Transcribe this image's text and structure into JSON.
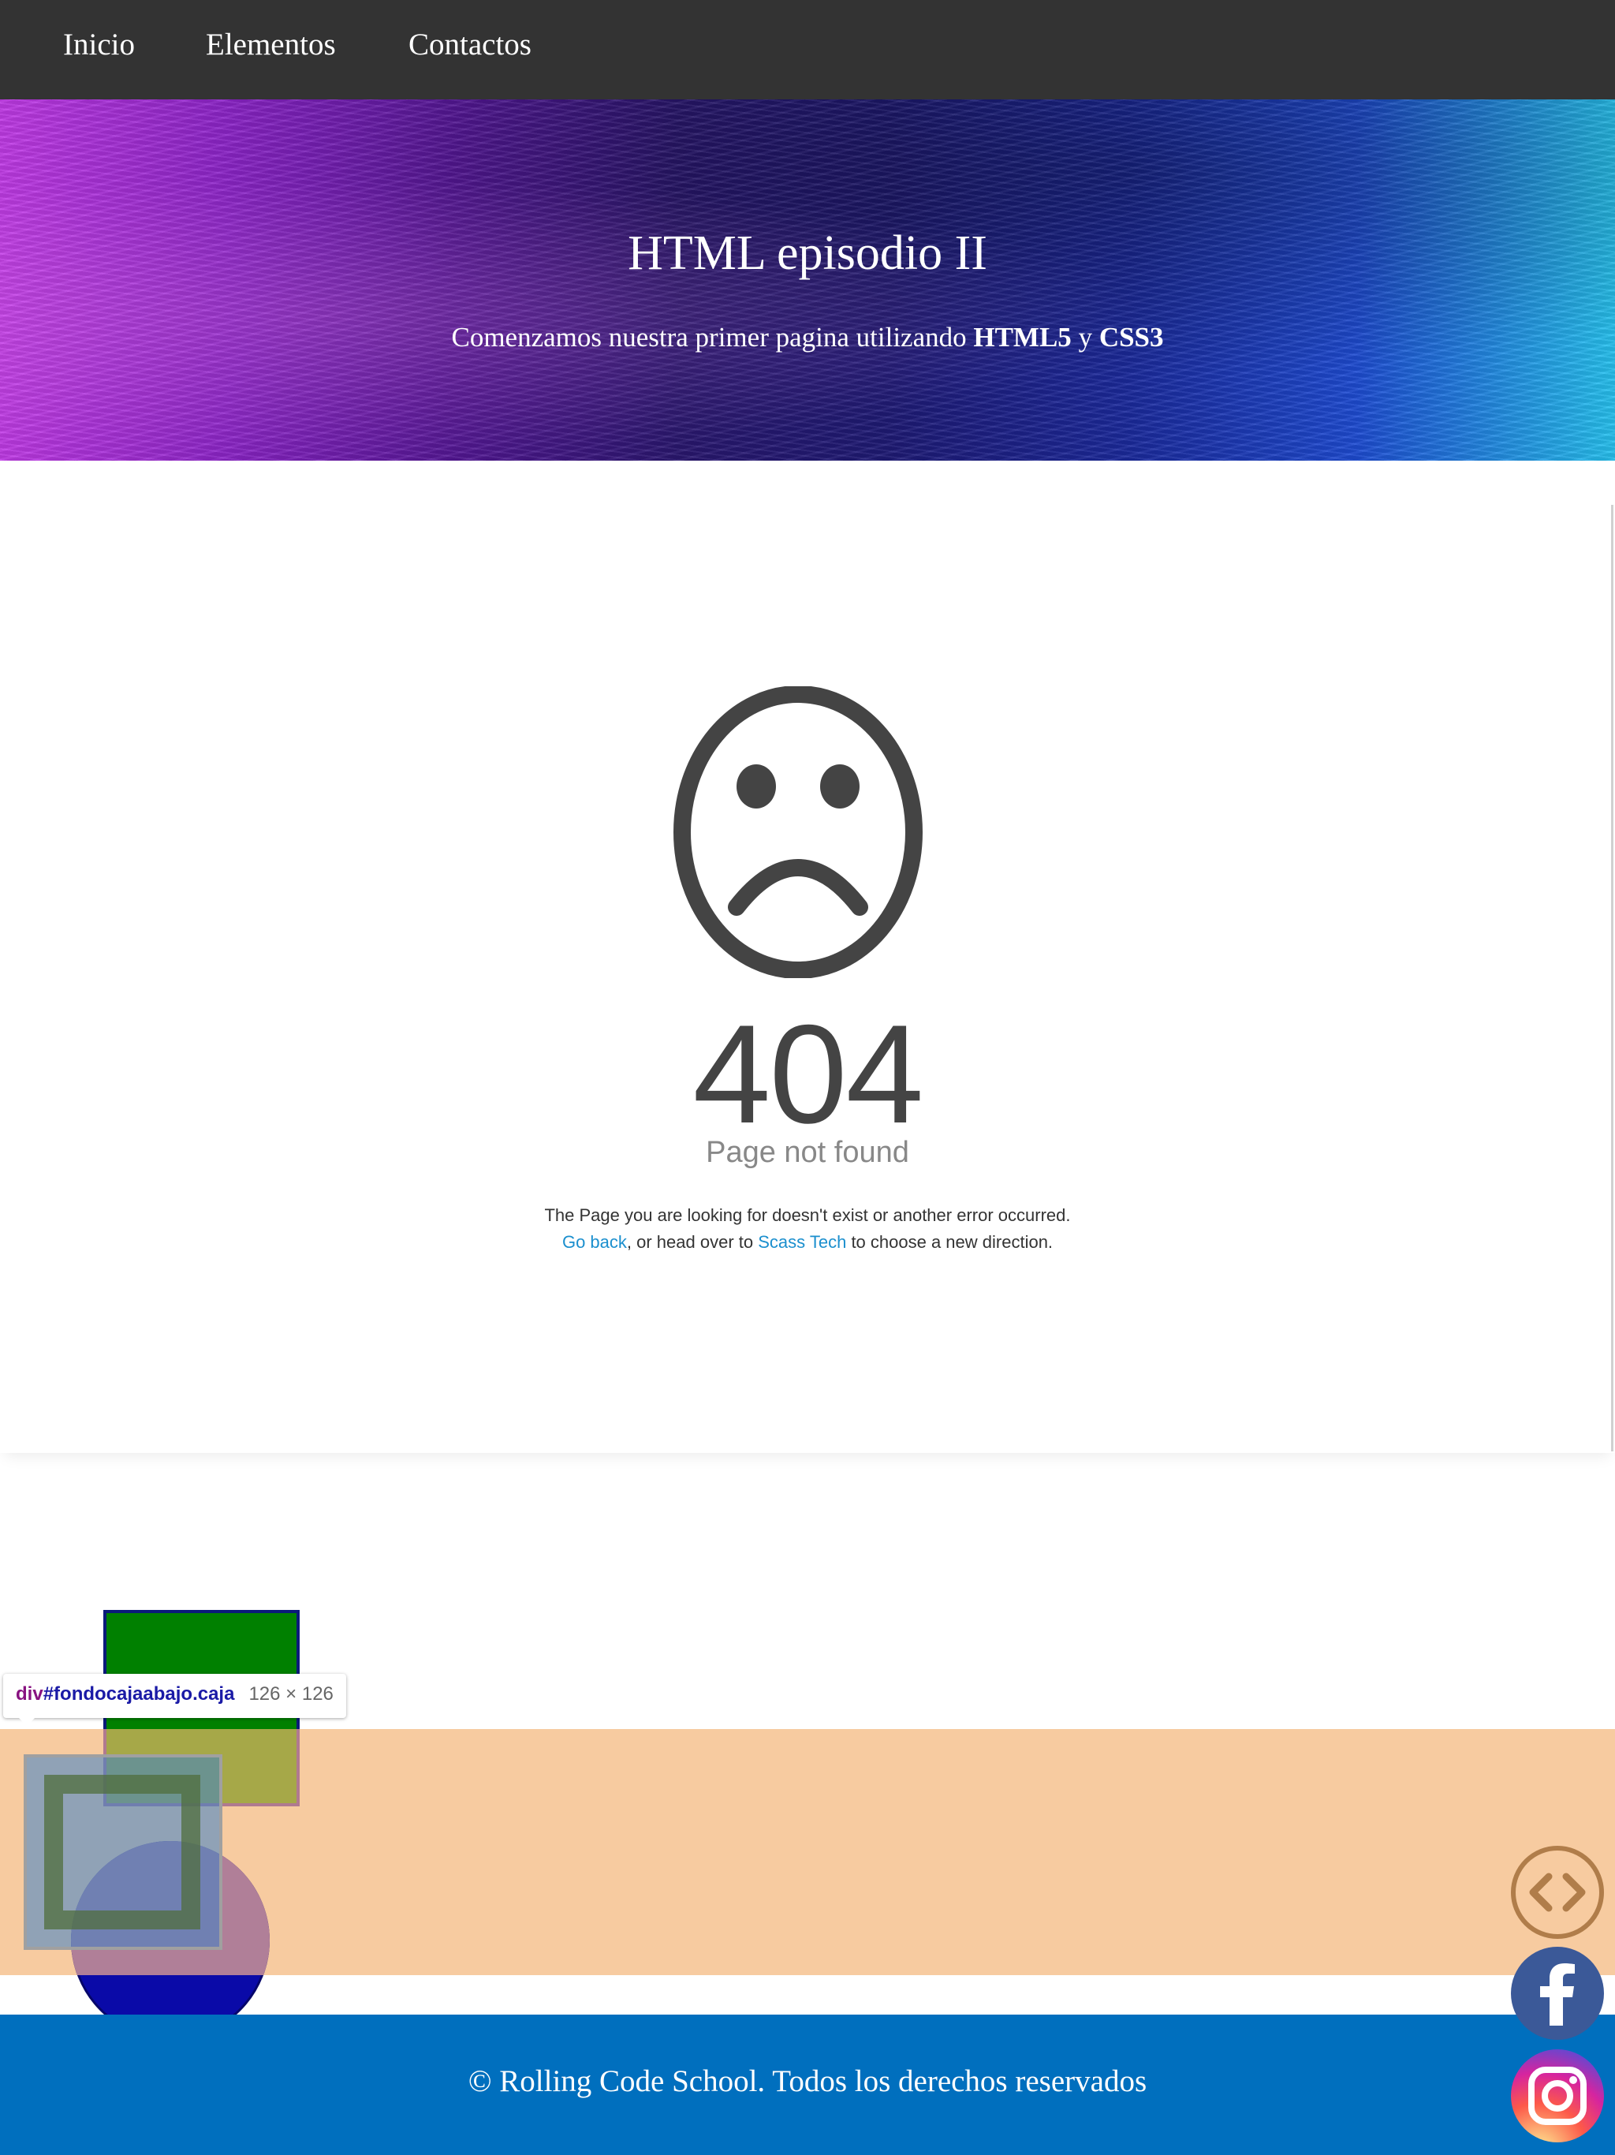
{
  "nav": {
    "items": [
      {
        "label": "Inicio"
      },
      {
        "label": "Elementos"
      },
      {
        "label": "Contactos"
      }
    ],
    "background": "#333333"
  },
  "hero": {
    "title": "HTML episodio II",
    "subtitle_pre": "Comenzamos nuestra primer pagina utilizando ",
    "subtitle_bold1": "HTML5",
    "subtitle_mid": " y ",
    "subtitle_bold2": "CSS3"
  },
  "error": {
    "icon": "sad-face-icon",
    "code": "404",
    "title": "Page not found",
    "message": "The Page you are looking for doesn't exist or another error occurred.",
    "go_back": "Go back",
    "middle": ", or head over to ",
    "site_link": "Scass Tech",
    "end": " to choose a new direction.",
    "link_color": "#1b8fce"
  },
  "devtools_tooltip": {
    "tag": "div",
    "selector": "#fondocajaabajo.caja",
    "size": "126 × 126"
  },
  "footer": {
    "text": "© Rolling Code School. Todos los derechos reservados",
    "background": "#006fbe"
  },
  "side_icons": [
    "code-icon",
    "facebook-icon",
    "instagram-icon"
  ],
  "colors": {
    "peach_band": "#f7cba0",
    "green_box": "#008000",
    "blue_circle": "#0a0aa8"
  }
}
